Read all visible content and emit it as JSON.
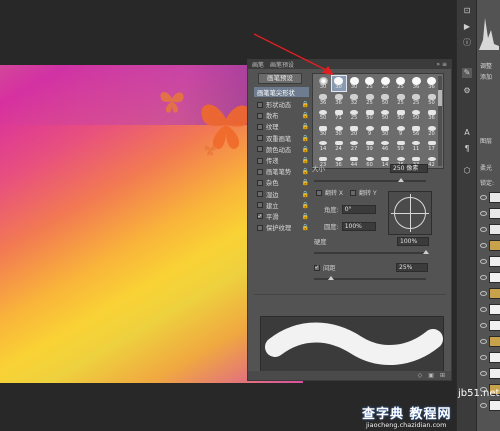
{
  "panel": {
    "tabs": [
      "画笔",
      "画笔预设"
    ],
    "preset_button": "画笔预设",
    "options": [
      {
        "label": "画笔笔尖形状",
        "checked": false,
        "selected": true,
        "lock": false
      },
      {
        "label": "形状动态",
        "checked": false,
        "selected": false,
        "lock": true
      },
      {
        "label": "散布",
        "checked": false,
        "selected": false,
        "lock": true
      },
      {
        "label": "纹理",
        "checked": false,
        "selected": false,
        "lock": true
      },
      {
        "label": "双重画笔",
        "checked": false,
        "selected": false,
        "lock": true
      },
      {
        "label": "颜色动态",
        "checked": false,
        "selected": false,
        "lock": true
      },
      {
        "label": "传递",
        "checked": false,
        "selected": false,
        "lock": true
      },
      {
        "label": "画笔笔势",
        "checked": false,
        "selected": false,
        "lock": true
      },
      {
        "label": "杂色",
        "checked": false,
        "selected": false,
        "lock": true
      },
      {
        "label": "湿边",
        "checked": false,
        "selected": false,
        "lock": true
      },
      {
        "label": "建立",
        "checked": false,
        "selected": false,
        "lock": true
      },
      {
        "label": "平滑",
        "checked": true,
        "selected": false,
        "lock": true
      },
      {
        "label": "保护纹理",
        "checked": false,
        "selected": false,
        "lock": true
      }
    ],
    "tips_rows": [
      [
        "30",
        "30",
        "30",
        "25",
        "25",
        "25",
        "36",
        "36"
      ],
      [
        "36",
        "36",
        "32",
        "25",
        "50",
        "25",
        "25",
        "50"
      ],
      [
        "50",
        "71",
        "25",
        "50",
        "50",
        "50",
        "50",
        "36"
      ],
      [
        "30",
        "30",
        "20",
        "9",
        "30",
        "9",
        "56",
        "20"
      ],
      [
        "14",
        "24",
        "27",
        "39",
        "46",
        "59",
        "11",
        "17"
      ],
      [
        "23",
        "36",
        "44",
        "60",
        "14",
        "26",
        "33",
        "42"
      ]
    ],
    "size_label": "大小",
    "size_value": "250 像素",
    "flip_x": "翻转 X",
    "flip_y": "翻转 Y",
    "angle_label": "角度:",
    "angle_value": "0°",
    "roundness_label": "圆度:",
    "roundness_value": "100%",
    "hardness_label": "硬度",
    "hardness_value": "100%",
    "spacing_label": "间距",
    "spacing_value": "25%"
  },
  "sidepanel": {
    "adjust_label": "调整",
    "add_label": "添加",
    "layers_label": "图层",
    "blend": "柔光",
    "lock": "锁定:"
  },
  "watermark": {
    "top": "jb51.net",
    "main": "查字典 教程网",
    "sub": "jiaocheng.chazidian.com"
  },
  "colors": {
    "panel_bg": "#535353",
    "app_bg": "#282828",
    "arrow": "#e02020",
    "selected_tip": "#8a9ab0"
  }
}
